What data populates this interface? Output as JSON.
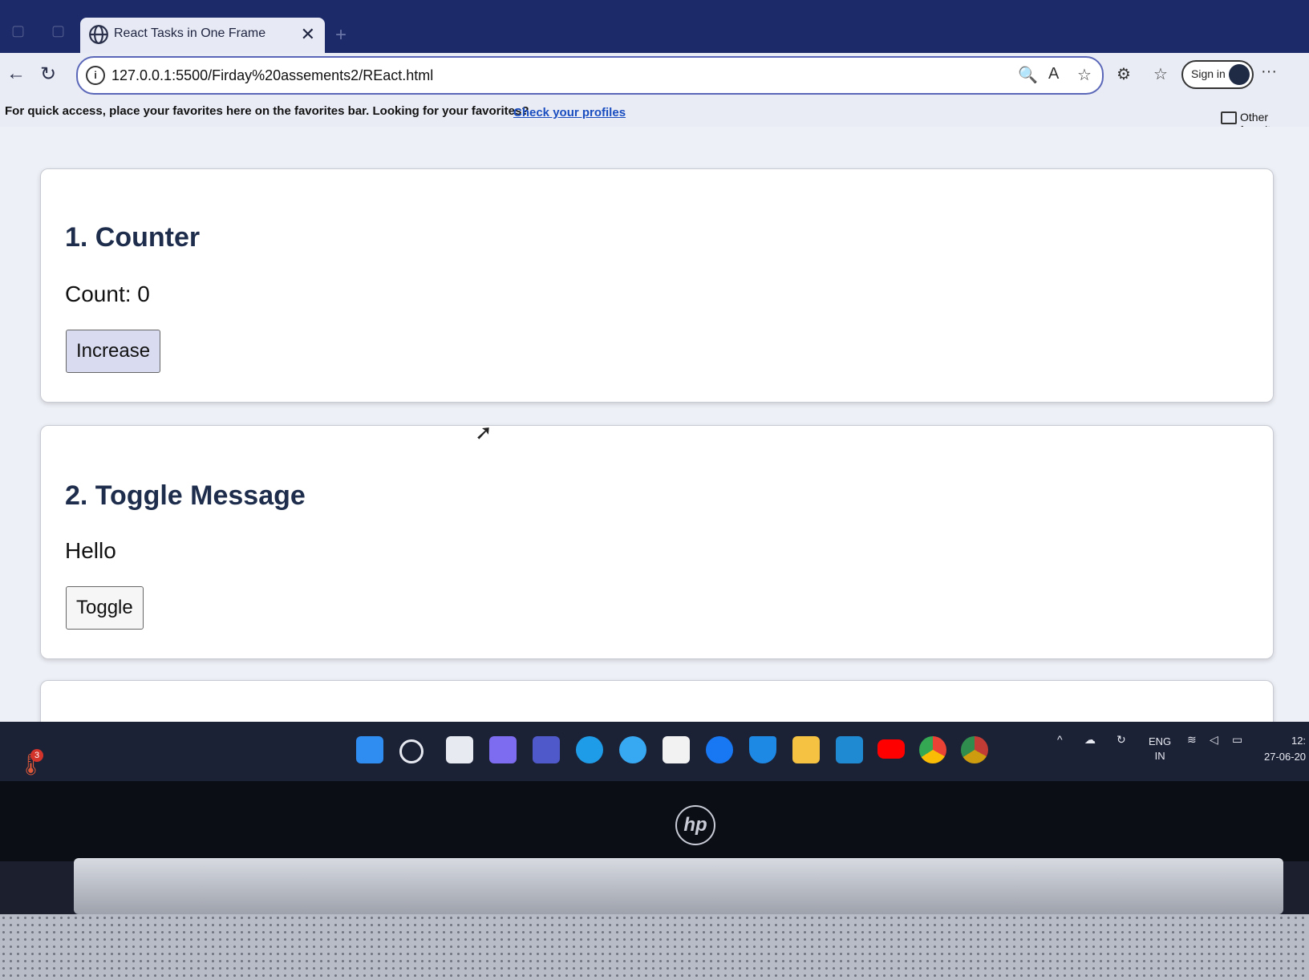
{
  "browser": {
    "tab": {
      "title": "React Tasks in One Frame",
      "close": "✕"
    },
    "new_tab": "+",
    "address": {
      "url": "127.0.0.1:5500/Firday%20assements2/REact.html"
    },
    "sign_in": "Sign in",
    "more": "···",
    "favorites_bar": {
      "message": "For quick access, place your favorites here on the favorites bar. Looking for your favorites?",
      "link": "Check your profiles",
      "other": "Other favorites"
    }
  },
  "page": {
    "counter": {
      "title": "1. Counter",
      "count_label": "Count: 0",
      "button": "Increase"
    },
    "toggle": {
      "title": "2. Toggle Message",
      "message": "Hello",
      "button": "Toggle"
    }
  },
  "taskbar": {
    "weather_badge": "3",
    "lang_line1": "ENG",
    "lang_line2": "IN",
    "time": "12:",
    "date": "27-06-20"
  },
  "laptop": {
    "logo": "hp"
  }
}
